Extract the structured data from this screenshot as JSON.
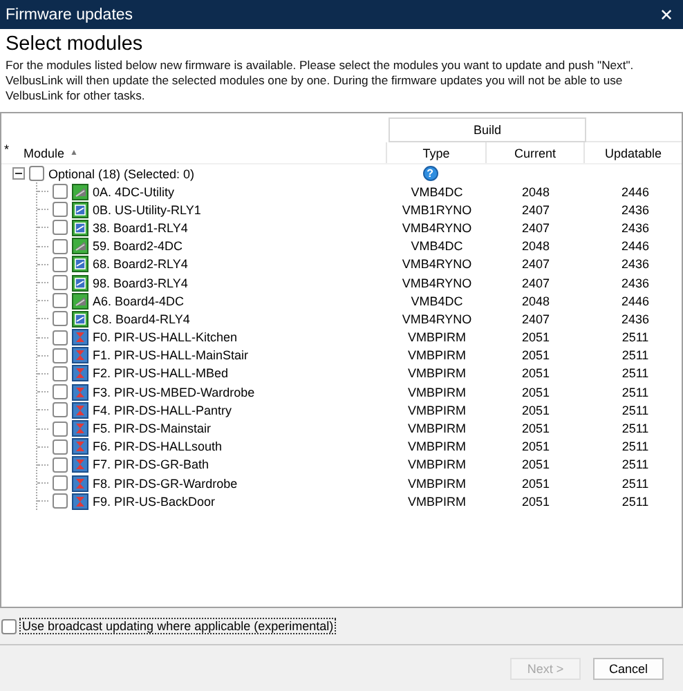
{
  "window": {
    "title": "Firmware updates",
    "close_glyph": "✕"
  },
  "heading": "Select modules",
  "description": "For the modules listed below new firmware is available. Please select the modules you want to update and push \"Next\". VelbusLink will then update the selected modules one by one. During the firmware updates you will not be able to use VelbusLink for other tasks.",
  "grid": {
    "band": "Build",
    "marker": "*",
    "sort_glyph": "▲",
    "help_glyph": "?",
    "columns": [
      "Module",
      "Type",
      "Current",
      "Updatable"
    ],
    "group": {
      "label": "Optional (18) (Selected: 0)",
      "checked": false,
      "expanded": true,
      "children": [
        {
          "name": "0A. 4DC-Utility",
          "kind": "dimmer",
          "type": "VMB4DC",
          "current": "2048",
          "updatable": "2446",
          "checked": false
        },
        {
          "name": "0B. US-Utility-RLY1",
          "kind": "relay",
          "type": "VMB1RYNO",
          "current": "2407",
          "updatable": "2436",
          "checked": false
        },
        {
          "name": "38. Board1-RLY4",
          "kind": "relay",
          "type": "VMB4RYNO",
          "current": "2407",
          "updatable": "2436",
          "checked": false
        },
        {
          "name": "59. Board2-4DC",
          "kind": "dimmer",
          "type": "VMB4DC",
          "current": "2048",
          "updatable": "2446",
          "checked": false
        },
        {
          "name": "68. Board2-RLY4",
          "kind": "relay",
          "type": "VMB4RYNO",
          "current": "2407",
          "updatable": "2436",
          "checked": false
        },
        {
          "name": "98. Board3-RLY4",
          "kind": "relay",
          "type": "VMB4RYNO",
          "current": "2407",
          "updatable": "2436",
          "checked": false
        },
        {
          "name": "A6. Board4-4DC",
          "kind": "dimmer",
          "type": "VMB4DC",
          "current": "2048",
          "updatable": "2446",
          "checked": false
        },
        {
          "name": "C8. Board4-RLY4",
          "kind": "relay",
          "type": "VMB4RYNO",
          "current": "2407",
          "updatable": "2436",
          "checked": false
        },
        {
          "name": "F0. PIR-US-HALL-Kitchen",
          "kind": "pir",
          "type": "VMBPIRM",
          "current": "2051",
          "updatable": "2511",
          "checked": false
        },
        {
          "name": "F1. PIR-US-HALL-MainStair",
          "kind": "pir",
          "type": "VMBPIRM",
          "current": "2051",
          "updatable": "2511",
          "checked": false
        },
        {
          "name": "F2. PIR-US-HALL-MBed",
          "kind": "pir",
          "type": "VMBPIRM",
          "current": "2051",
          "updatable": "2511",
          "checked": false
        },
        {
          "name": "F3. PIR-US-MBED-Wardrobe",
          "kind": "pir",
          "type": "VMBPIRM",
          "current": "2051",
          "updatable": "2511",
          "checked": false
        },
        {
          "name": "F4. PIR-DS-HALL-Pantry",
          "kind": "pir",
          "type": "VMBPIRM",
          "current": "2051",
          "updatable": "2511",
          "checked": false
        },
        {
          "name": "F5. PIR-DS-Mainstair",
          "kind": "pir",
          "type": "VMBPIRM",
          "current": "2051",
          "updatable": "2511",
          "checked": false
        },
        {
          "name": "F6. PIR-DS-HALLsouth",
          "kind": "pir",
          "type": "VMBPIRM",
          "current": "2051",
          "updatable": "2511",
          "checked": false
        },
        {
          "name": "F7. PIR-DS-GR-Bath",
          "kind": "pir",
          "type": "VMBPIRM",
          "current": "2051",
          "updatable": "2511",
          "checked": false
        },
        {
          "name": "F8. PIR-DS-GR-Wardrobe",
          "kind": "pir",
          "type": "VMBPIRM",
          "current": "2051",
          "updatable": "2511",
          "checked": false
        },
        {
          "name": "F9. PIR-US-BackDoor",
          "kind": "pir",
          "type": "VMBPIRM",
          "current": "2051",
          "updatable": "2511",
          "checked": false
        }
      ]
    }
  },
  "broadcast": {
    "label": "Use broadcast updating where applicable (experimental)",
    "checked": false
  },
  "buttons": [
    {
      "label": "Next >",
      "disabled": true
    },
    {
      "label": "Cancel",
      "disabled": false
    }
  ]
}
